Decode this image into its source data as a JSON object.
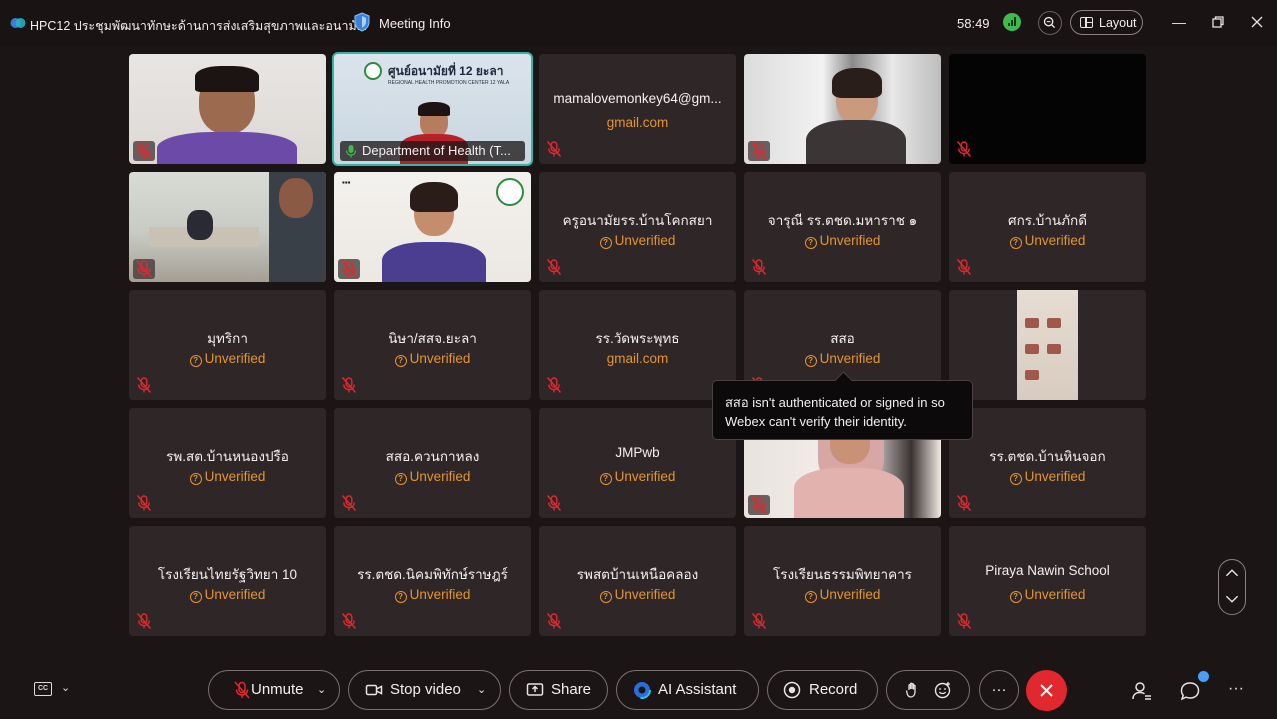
{
  "window": {
    "title": "HPC12 ประชุมพัฒนาทักษะด้านการส่งเสริมสุขภาพและอนามั...",
    "meeting_info": "Meeting Info",
    "timer": "58:49",
    "layout_label": "Layout",
    "accent": "#37b3a5"
  },
  "tiles": [
    {
      "name": "",
      "sub": "",
      "kind": "video"
    },
    {
      "name": "Department of Health (T...",
      "sub": "",
      "kind": "video-active"
    },
    {
      "name": "mamalovemonkey64@gm...",
      "sub": "gmail.com",
      "kind": "domain"
    },
    {
      "name": "",
      "sub": "",
      "kind": "video"
    },
    {
      "name": "",
      "sub": "",
      "kind": "black"
    },
    {
      "name": "",
      "sub": "",
      "kind": "video"
    },
    {
      "name": "",
      "sub": "",
      "kind": "video"
    },
    {
      "name": "ครูอนามัยรร.บ้านโคกสยา",
      "sub": "Unverified",
      "kind": "unverified"
    },
    {
      "name": "จารุณี  รร.ตชด.มหาราช ๑",
      "sub": "Unverified",
      "kind": "unverified"
    },
    {
      "name": "ศกร.บ้านภักดี",
      "sub": "Unverified",
      "kind": "unverified"
    },
    {
      "name": "มุทริกา",
      "sub": "Unverified",
      "kind": "unverified"
    },
    {
      "name": "นิษา/สสจ.ยะลา",
      "sub": "Unverified",
      "kind": "unverified"
    },
    {
      "name": "รร.วัดพระพุทธ",
      "sub": "gmail.com",
      "kind": "domain"
    },
    {
      "name": "สสอ",
      "sub": "Unverified",
      "kind": "unverified"
    },
    {
      "name": "",
      "sub": "",
      "kind": "video-narrow"
    },
    {
      "name": "รพ.สต.บ้านหนองปรือ",
      "sub": "Unverified",
      "kind": "unverified"
    },
    {
      "name": "สสอ.ควนกาหลง",
      "sub": "Unverified",
      "kind": "unverified"
    },
    {
      "name": "JMPwb",
      "sub": "Unverified",
      "kind": "unverified"
    },
    {
      "name": "",
      "sub": "",
      "kind": "video"
    },
    {
      "name": "รร.ตชด.บ้านหินจอก",
      "sub": "Unverified",
      "kind": "unverified"
    },
    {
      "name": "โรงเรียนไทยรัฐวิทยา 10",
      "sub": "Unverified",
      "kind": "unverified"
    },
    {
      "name": "รร.ตชด.นิคมพิทักษ์ราษฎร์",
      "sub": "Unverified",
      "kind": "unverified"
    },
    {
      "name": "รพสตบ้านเหนือคลอง",
      "sub": "Unverified",
      "kind": "unverified"
    },
    {
      "name": "โรงเรียนธรรมพิทยาคาร",
      "sub": "Unverified",
      "kind": "unverified"
    },
    {
      "name": "Piraya Nawin School",
      "sub": "Unverified",
      "kind": "unverified"
    }
  ],
  "video_texts": {
    "banner_title": "ศูนย์อนามัยที่ 12 ยะลา",
    "banner_sub": "REGIONAL HEALTH PROMOTION CENTER 12 YALA"
  },
  "tooltip": {
    "text": "สสอ isn't authenticated or signed in so Webex can't verify their identity."
  },
  "controls": {
    "cc": "CC",
    "unmute": "Unmute",
    "stop_video": "Stop video",
    "share": "Share",
    "ai_assistant": "AI Assistant",
    "record": "Record",
    "more": "···",
    "leave_color": "#e0282e"
  }
}
